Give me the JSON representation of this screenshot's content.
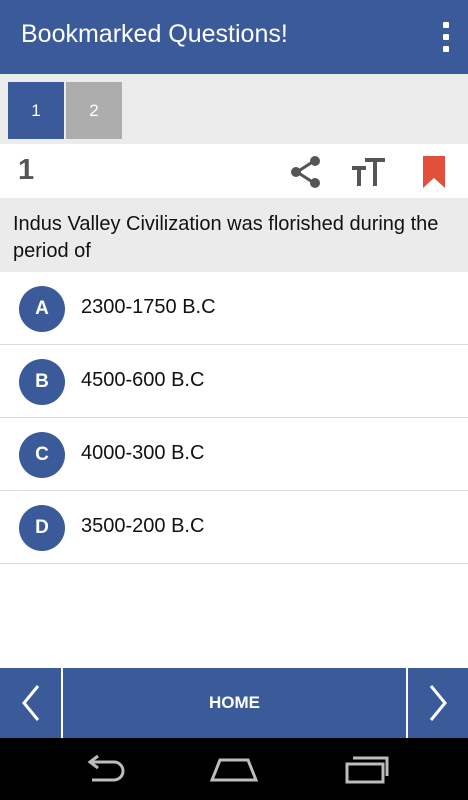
{
  "app_bar": {
    "title": "Bookmarked Questions!",
    "overflow_icon": "more-vert-icon"
  },
  "question_tabs": [
    {
      "label": "1",
      "active": true
    },
    {
      "label": "2",
      "active": false
    }
  ],
  "question": {
    "number": "1",
    "text": "Indus Valley Civilization was florished during the period of",
    "tools": [
      "share-icon",
      "text-size-icon",
      "bookmark-icon"
    ]
  },
  "options": [
    {
      "letter": "A",
      "text": "2300-1750 B.C"
    },
    {
      "letter": "B",
      "text": "4500-600 B.C"
    },
    {
      "letter": "C",
      "text": "4000-300 B.C"
    },
    {
      "letter": "D",
      "text": "3500-200 B.C"
    }
  ],
  "bottom_nav": {
    "home_label": "HOME",
    "prev_icon": "chevron-left-icon",
    "next_icon": "chevron-right-icon"
  },
  "system_nav": [
    "back-icon",
    "home-icon",
    "recents-icon"
  ],
  "colors": {
    "primary": "#3a5a99",
    "bookmark": "#e0503a",
    "inactive_tab": "#adadad",
    "question_bg": "#ebebeb"
  }
}
